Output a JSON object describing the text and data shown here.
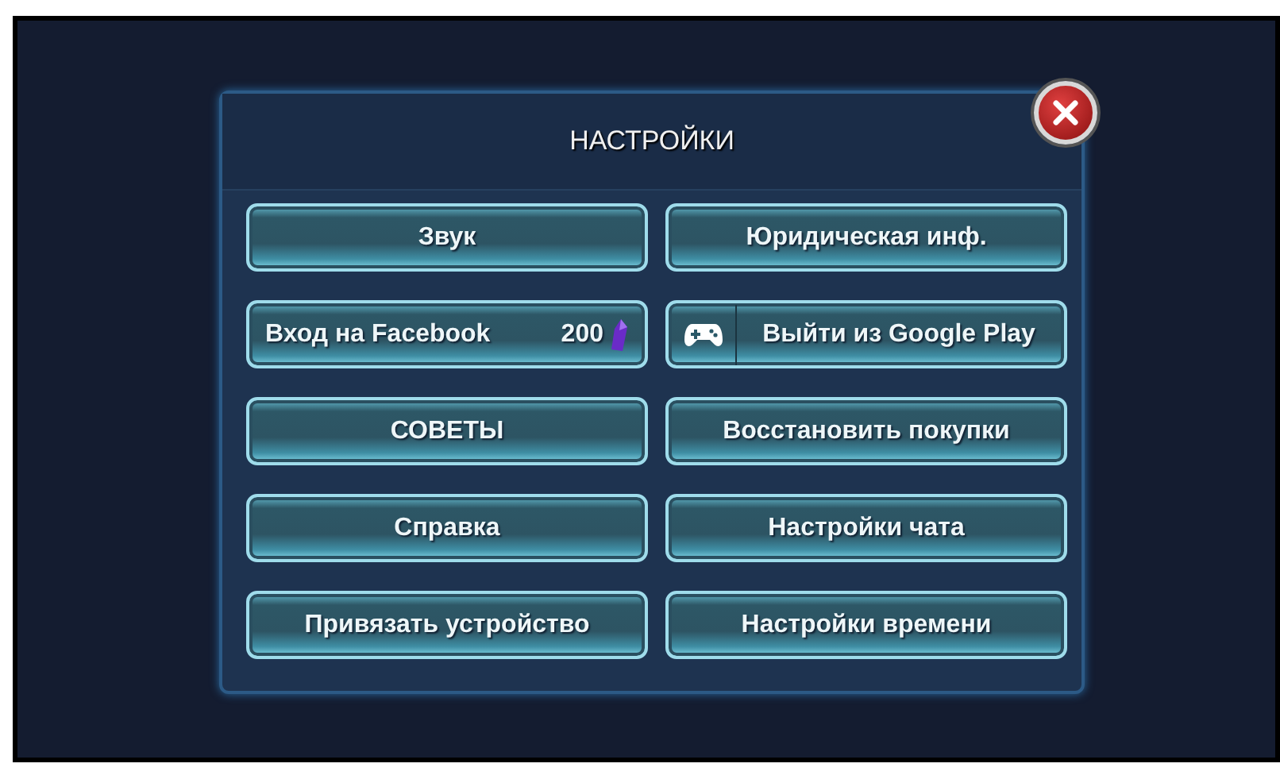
{
  "dialog": {
    "title": "НАСТРОЙКИ",
    "buttons": [
      {
        "kind": "plain",
        "label": "Звук"
      },
      {
        "kind": "plain",
        "label": "Юридическая инф."
      },
      {
        "kind": "reward",
        "label": "Вход на Facebook",
        "amount": "200"
      },
      {
        "kind": "gamepad",
        "label": "Выйти из Google Play"
      },
      {
        "kind": "plain",
        "label": "СОВЕТЫ"
      },
      {
        "kind": "plain",
        "label": "Восстановить покупки"
      },
      {
        "kind": "plain",
        "label": "Справка"
      },
      {
        "kind": "plain",
        "label": "Настройки чата"
      },
      {
        "kind": "plain",
        "label": "Привязать устройство"
      },
      {
        "kind": "plain",
        "label": "Настройки времени"
      }
    ]
  }
}
